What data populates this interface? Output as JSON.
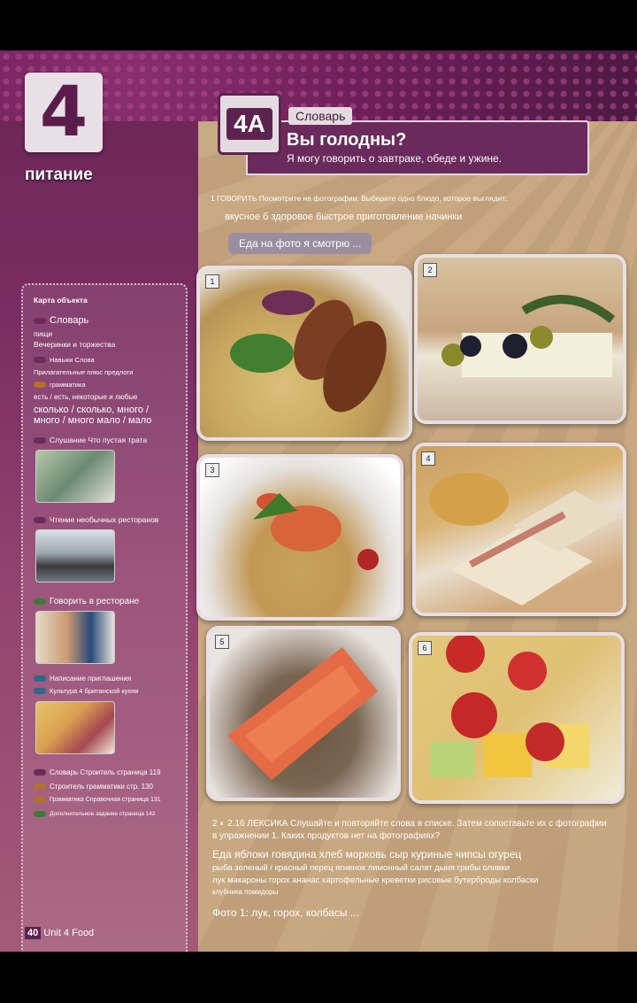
{
  "unit": {
    "number": "4",
    "name": "питание"
  },
  "lesson": {
    "code": "4A",
    "tag": "Словарь",
    "title": "Вы голодны?",
    "subtitle": "Я могу говорить о завтраке, обеде и ужине."
  },
  "exercise1": {
    "instruction": "1 ГОВОРИТЬ Посмотрите на фотографии. Выберите одно блюдо, которое выглядит:",
    "words": "вкусное б здоровое быстрое приготовление начинки",
    "speech": "Еда на фото я смотрю ..."
  },
  "photos": [
    "1",
    "2",
    "3",
    "4",
    "5",
    "6"
  ],
  "sidebar": {
    "title": "Карта объекта",
    "items": [
      {
        "type": "heading",
        "label": "Словарь",
        "color": "#6b2a5c"
      },
      {
        "type": "text",
        "label": "пищи"
      },
      {
        "type": "text",
        "label": "Вечеринки и торжества"
      },
      {
        "type": "heading",
        "label": "Навыки Слова",
        "color": "#6b2a5c"
      },
      {
        "type": "text",
        "label": "Прилагательные плюс предлоги"
      },
      {
        "type": "heading",
        "label": "грамматика",
        "color": "#b3712a"
      },
      {
        "type": "text",
        "label": "есть / есть, некоторые и любые"
      },
      {
        "type": "text",
        "label": "сколько / сколько, много / много / много мало / мало"
      },
      {
        "type": "heading",
        "label": "Слушание Что пустая трата",
        "color": "#6b2a5c"
      },
      {
        "type": "heading",
        "label": "Чтение необычных ресторанов",
        "color": "#6b2a5c"
      },
      {
        "type": "heading",
        "label": "Говорить в ресторане",
        "color": "#3f7a3a"
      },
      {
        "type": "heading",
        "label": "Написание приглашения",
        "color": "#2a6a8a"
      },
      {
        "type": "heading",
        "label": "Культура 4 британской кухни",
        "color": "#2a6a8a"
      },
      {
        "type": "heading",
        "label": "Словарь Строитель страница 119",
        "color": "#6b2a5c"
      },
      {
        "type": "heading",
        "label": "Строитель грамматики стр. 130",
        "color": "#b3712a"
      },
      {
        "type": "heading",
        "label": "Грамматика Справочная страница 131",
        "color": "#b3712a"
      },
      {
        "type": "heading",
        "label": "Дополнительное задание страница 142",
        "color": "#3f7a3a"
      }
    ]
  },
  "exercise2": {
    "instruction": "2 ◐ 2.16 ЛЕКСИКА Слушайте и повторяйте слова в списке. Затем сопоставьте их с фотографии в упражнении 1. Каких продуктов нет на фотографиях?",
    "line1": "Еда яблоки говядина хлеб морковь сыр куриные чипсы огурец",
    "line2": "рыба зеленый / красный перец ягненок лимонный салат дыня грибы оливки",
    "line3": "лук макароны горох ананас картофельные креветки рисовые бутерброды колбаски",
    "line4": "клубника помидоры",
    "answer": "Фото 1: лук, горох, колбасы ..."
  },
  "footer": {
    "page": "40",
    "unit_label": "Unit 4 Food"
  }
}
